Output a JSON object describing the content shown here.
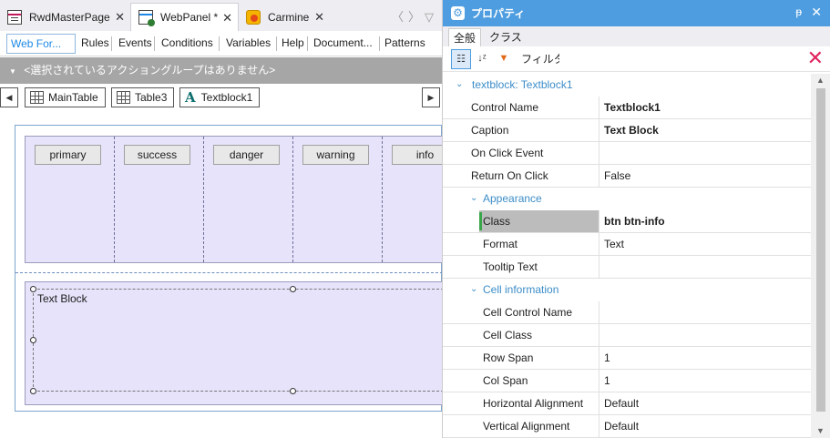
{
  "doc_tabs": [
    {
      "label": "RwdMasterPage",
      "icon": "master-page-icon"
    },
    {
      "label": "WebPanel *",
      "icon": "web-panel-icon"
    },
    {
      "label": "Carmine",
      "icon": "theme-icon"
    }
  ],
  "editor_tabs": [
    "Web For...",
    "Rules",
    "Events",
    "Conditions",
    "Variables",
    "Help",
    "Document...",
    "Patterns"
  ],
  "action_bar": "<選択されているアクショングループはありません>",
  "breadcrumb": [
    "MainTable",
    "Table3",
    "Textblock1"
  ],
  "buttons": [
    "primary",
    "success",
    "danger",
    "warning",
    "info"
  ],
  "textblock_caption": "Text Block",
  "props": {
    "title": "プロパティ",
    "tabs": [
      "全般",
      "クラス"
    ],
    "filter_label": "フィルタ",
    "filter_value": "",
    "header": "textblock: Textblock1",
    "rows": [
      {
        "name": "Control Name",
        "value": "Textblock1",
        "bold": true
      },
      {
        "name": "Caption",
        "value": "Text Block",
        "bold": true
      },
      {
        "name": "On Click Event",
        "value": ""
      },
      {
        "name": "Return On Click",
        "value": "False"
      },
      {
        "name": "Appearance",
        "category": true
      },
      {
        "name": "Class",
        "value": "btn btn-info",
        "bold": true,
        "selected": true
      },
      {
        "name": "Format",
        "value": "Text"
      },
      {
        "name": "Tooltip Text",
        "value": ""
      },
      {
        "name": "Cell information",
        "category": true
      },
      {
        "name": "Cell Control Name",
        "value": ""
      },
      {
        "name": "Cell Class",
        "value": ""
      },
      {
        "name": "Row Span",
        "value": "1"
      },
      {
        "name": "Col Span",
        "value": "1"
      },
      {
        "name": "Horizontal Alignment",
        "value": "Default"
      },
      {
        "name": "Vertical Alignment",
        "value": "Default"
      }
    ]
  },
  "colors": {
    "accent": "#4d9de0",
    "category": "#3c8dc8",
    "cell_bg": "#e6e3fa"
  }
}
